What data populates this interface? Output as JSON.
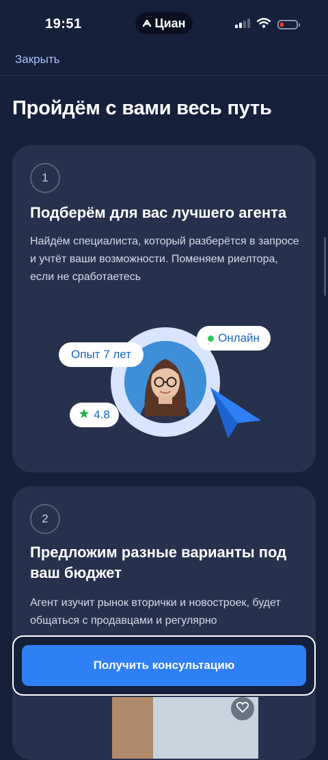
{
  "status_bar": {
    "time": "19:51",
    "carrier_app": "Циан",
    "battery_color": "#ff3b30"
  },
  "nav": {
    "close_label": "Закрыть"
  },
  "page": {
    "title": "Пройдём с вами весь путь"
  },
  "steps": [
    {
      "number": "1",
      "title": "Подберём для вас лучшего агента",
      "text": "Найдём специалиста, который разберётся в запросе и учтёт ваши возможности. Поменяем риелтора, если не сработаетесь",
      "badges": {
        "experience": "Опыт 7 лет",
        "status": "Онлайн",
        "rating": "4.8"
      }
    },
    {
      "number": "2",
      "title": "Предложим разные варианты под ваш бюджет",
      "text": "Агент изучит рынок вторички и новостроек, будет общаться с продавцами и регулярно"
    }
  ],
  "cta": {
    "label": "Получить консультацию"
  },
  "colors": {
    "background": "#15203a",
    "card": "#26324d",
    "accent": "#2f7ff5",
    "link": "#a9c2ff",
    "online": "#2ec55b"
  },
  "icons": [
    "cian-logo-icon",
    "signal-icon",
    "wifi-icon",
    "battery-icon",
    "star-icon",
    "cursor-arrow-icon",
    "heart-icon"
  ]
}
